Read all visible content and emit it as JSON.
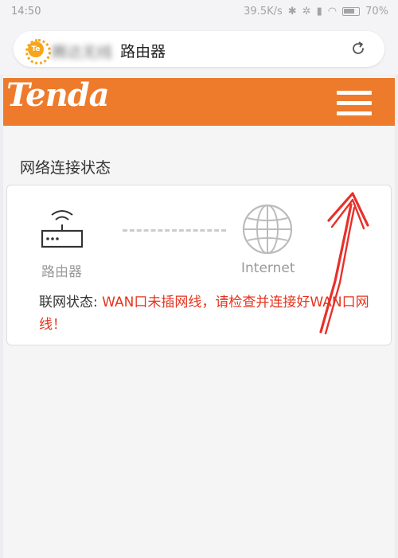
{
  "status_bar": {
    "time": "14:50",
    "speed": "39.5K/s",
    "battery": "70%"
  },
  "browser": {
    "site_icon_text": "Te",
    "site_name_blurred": "腾达无线",
    "site_name": "路由器"
  },
  "brand": {
    "logo": "Tenda",
    "accent_color": "#ee7b2c"
  },
  "main": {
    "section_title": "网络连接状态",
    "router_label": "路由器",
    "internet_label": "Internet",
    "status_label": "联网状态: ",
    "status_message": "WAN口未插网线，请检查并连接好WAN口网线！",
    "warning_color": "#e6331d"
  }
}
